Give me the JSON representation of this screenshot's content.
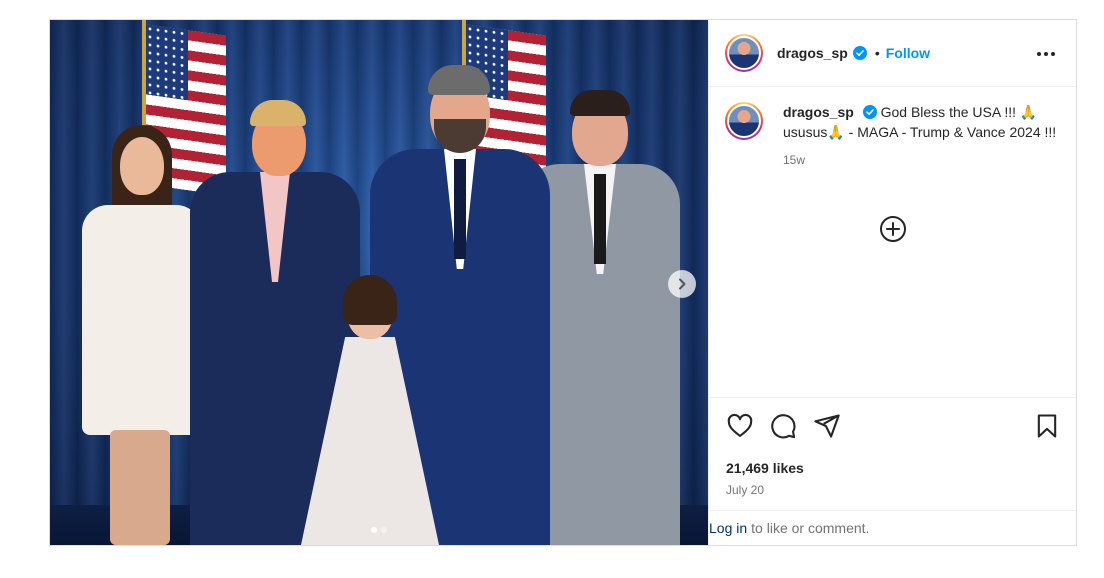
{
  "post": {
    "username": "dragos_sp",
    "follow_label": "Follow",
    "separator": "•",
    "caption_text": "God Bless the USA !!! 🙏 usus​us🙏 - MAGA - Trump & Vance 2024 !!!",
    "time_ago": "15w",
    "likes": "21,469 likes",
    "date": "July 20",
    "login_link": "Log in",
    "login_suffix": "to like or comment.",
    "photo_count": 2,
    "active_photo": 1
  },
  "icons": {
    "verified": "verified-badge-icon",
    "more": "more-options-icon",
    "add": "add-circle-icon",
    "like": "heart-icon",
    "comment": "comment-icon",
    "share": "send-icon",
    "save": "bookmark-icon",
    "next": "chevron-right-icon"
  },
  "colors": {
    "accent": "#0095f6",
    "text": "#262626",
    "muted": "#737373",
    "link": "#00376b",
    "border": "#dbdbdb"
  }
}
